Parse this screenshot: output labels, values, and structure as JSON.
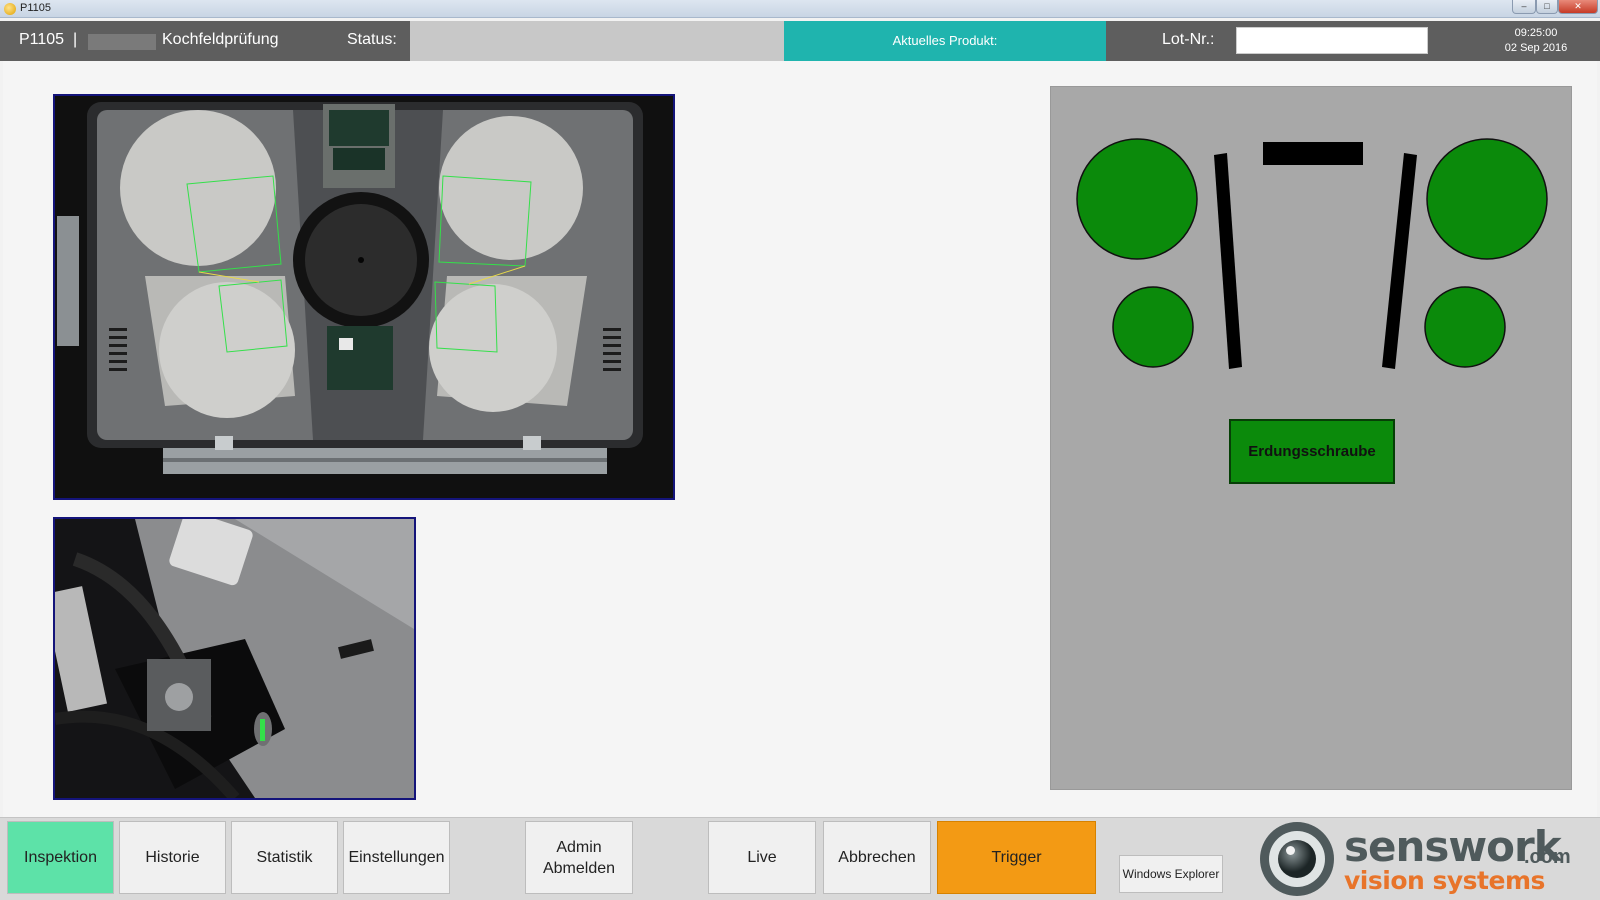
{
  "window": {
    "title": "P1105",
    "min": "–",
    "max": "□",
    "close": "✕"
  },
  "header": {
    "station_id": "P1105",
    "separator": "|",
    "test_name": "Kochfeldprüfung",
    "status_label": "Status:",
    "status_value": "",
    "product_label": "Aktuelles Produkt:",
    "lot_label": "Lot-Nr.:",
    "lot_value": "",
    "time": "09:25:00",
    "date": "02 Sep 2016"
  },
  "status_panel": {
    "screw_label": "Erdungsschraube",
    "ok_color": "#0b8a0b",
    "panel_color": "#a8a8a8"
  },
  "toolbar": {
    "inspection": "Inspektion",
    "history": "Historie",
    "statistics": "Statistik",
    "settings": "Einstellungen",
    "admin_line1": "Admin",
    "admin_line2": "Abmelden",
    "live": "Live",
    "cancel": "Abbrechen",
    "trigger": "Trigger",
    "explorer": "Windows Explorer"
  },
  "logo": {
    "name": "senswork",
    "domain": ".com",
    "tagline": "vision systems",
    "icon": "camera-lens-icon"
  },
  "colors": {
    "header_bg": "#5e5e5e",
    "product_bg": "#1fb4ae",
    "inspection_active": "#5de2a8",
    "trigger": "#f39a14"
  }
}
